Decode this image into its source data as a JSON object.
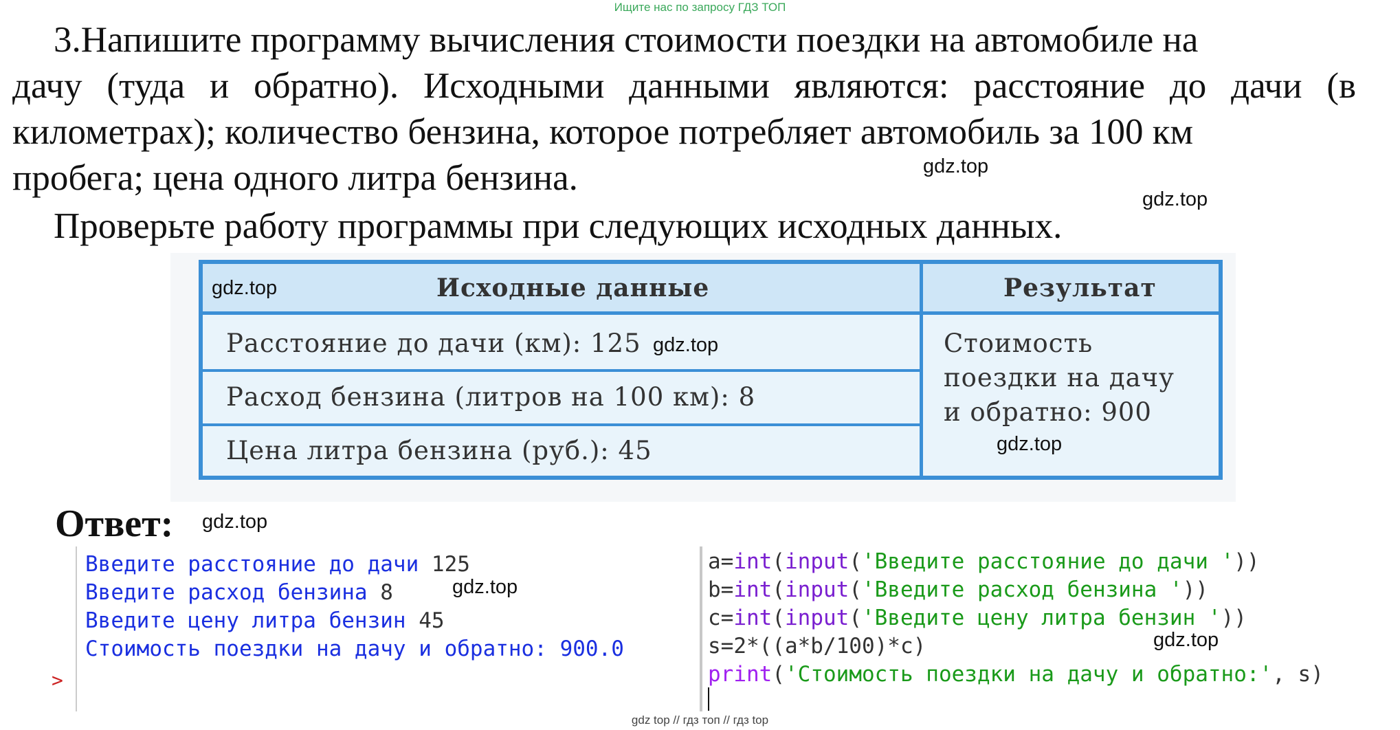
{
  "banner": "Ищите нас по запросу ГДЗ ТОП",
  "task": {
    "line1": "3.Напишите программу вычисления стоимости поездки на автомобиле на",
    "line2": "дачу (туда и обратно). Исходными данными являются: расстояние до дачи (в",
    "line3": "километрах); количество бензина, которое потребляет автомобиль за 100 км",
    "line4": "пробега; цена одного литра бензина.",
    "check": "Проверьте работу программы при следующих исходных данных."
  },
  "watermark": "gdz.top",
  "table": {
    "header_input": "Исходные данные",
    "header_result": "Результат",
    "rows": [
      "Расстояние до дачи (км): 125",
      "Расход бензина (литров на 100 км): 8",
      "Цена литра бензина (руб.): 45"
    ],
    "result_lines": [
      "Стоимость",
      "поездки на дачу",
      "и обратно: 900"
    ]
  },
  "answer_label": "Ответ:",
  "shell": {
    "lines": [
      {
        "prompt": "Введите расстояние до дачи ",
        "value": "125"
      },
      {
        "prompt": "Введите расход бензина ",
        "value": "8"
      },
      {
        "prompt": "Введите цену литра бензин ",
        "value": "45"
      },
      {
        "prompt": "Стоимость поездки на дачу и обратно: ",
        "value": "900.0"
      }
    ],
    "prompt_symbol": ">"
  },
  "editor": {
    "lines": [
      {
        "a": "a=",
        "b": "int",
        "c": "(",
        "d": "input",
        "e": "(",
        "f": "'Введите расстояние до дачи '",
        "g": "))"
      },
      {
        "a": "b=",
        "b": "int",
        "c": "(",
        "d": "input",
        "e": "(",
        "f": "'Введите расход бензина '",
        "g": "))"
      },
      {
        "a": "c=",
        "b": "int",
        "c": "(",
        "d": "input",
        "e": "(",
        "f": "'Введите цену литра бензин '",
        "g": "))"
      }
    ],
    "line4": "s=2*((a*b/100)*c)",
    "line5_fn": "print",
    "line5_open": "(",
    "line5_str": "'Стоимость поездки на дачу и обратно:'",
    "line5_rest": ", s)"
  },
  "footer": "gdz top  //  гдз топ  //  гдз top"
}
